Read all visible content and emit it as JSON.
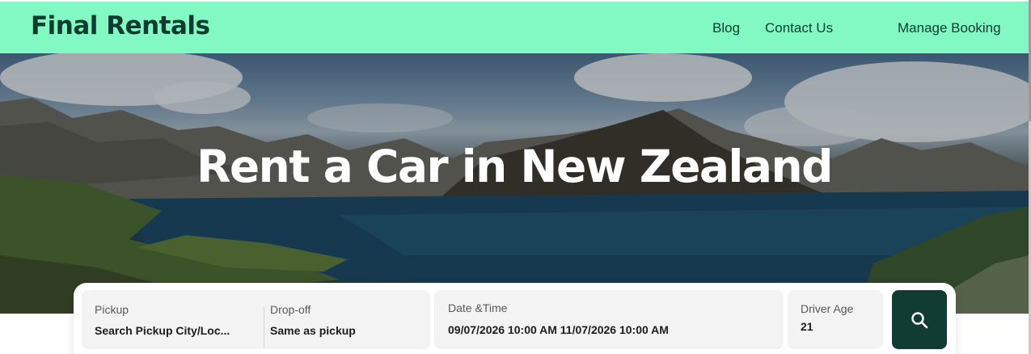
{
  "header": {
    "logo_text": "Final Rentals",
    "nav": {
      "blog": "Blog",
      "contact": "Contact Us",
      "manage": "Manage Booking"
    }
  },
  "hero": {
    "title": "Rent a Car in New Zealand"
  },
  "search": {
    "pickup_label": "Pickup",
    "pickup_value": "Search Pickup City/Loc...",
    "dropoff_label": "Drop-off",
    "dropoff_value": "Same as pickup",
    "datetime_label": "Date &Time",
    "datetime_value": "09/07/2026 10:00 AM 11/07/2026 10:00 AM",
    "age_label": "Driver Age",
    "age_value": "21",
    "button_icon": "search-icon"
  },
  "colors": {
    "header_bg": "#82f8c3",
    "brand_dark": "#0f3b30",
    "button_bg": "#113c33"
  }
}
